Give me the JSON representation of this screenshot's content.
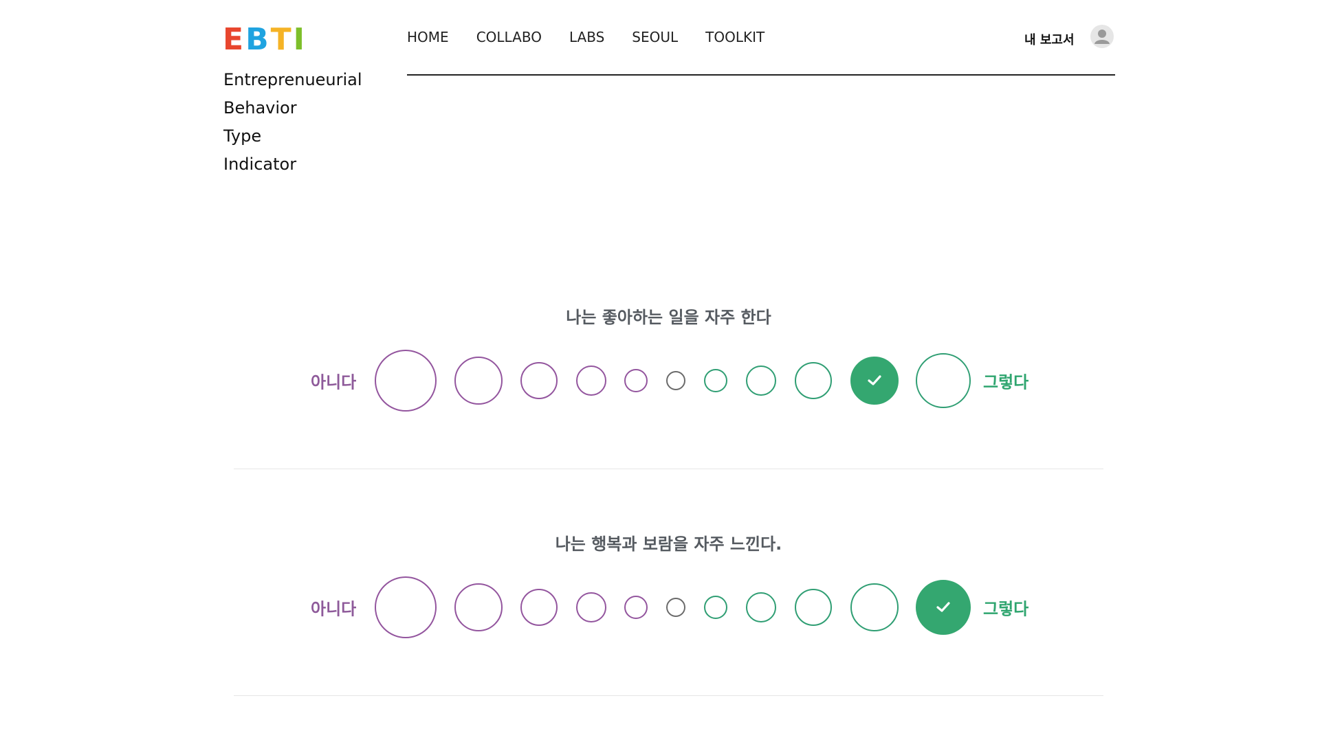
{
  "brand": {
    "logo_letters": [
      {
        "char": "E",
        "color": "#e8462e"
      },
      {
        "char": "B",
        "color": "#1fa3e0"
      },
      {
        "char": "T",
        "color": "#f5b326"
      },
      {
        "char": "I",
        "color": "#7dbf2a"
      }
    ],
    "tagline": [
      "Entreprenueurial",
      "Behavior",
      "Type",
      "Indicator"
    ]
  },
  "nav": {
    "items": [
      "HOME",
      "COLLABO",
      "LABS",
      "SEOUL",
      "TOOLKIT"
    ],
    "report_label": "내 보고서",
    "avatar_icon": "user-avatar-icon"
  },
  "scale": {
    "left_label": "아니다",
    "right_label": "그렇다",
    "colors": {
      "disagree": "#93559e",
      "neutral": "#6a6a6a",
      "agree": "#2f9e73",
      "selected": "#34a770"
    },
    "options": 11
  },
  "questions": [
    {
      "text": "나는 좋아하는 일을 자주 한다",
      "selected_index": 9
    },
    {
      "text": "나는 행복과 보람을 자주 느낀다.",
      "selected_index": 10
    }
  ]
}
